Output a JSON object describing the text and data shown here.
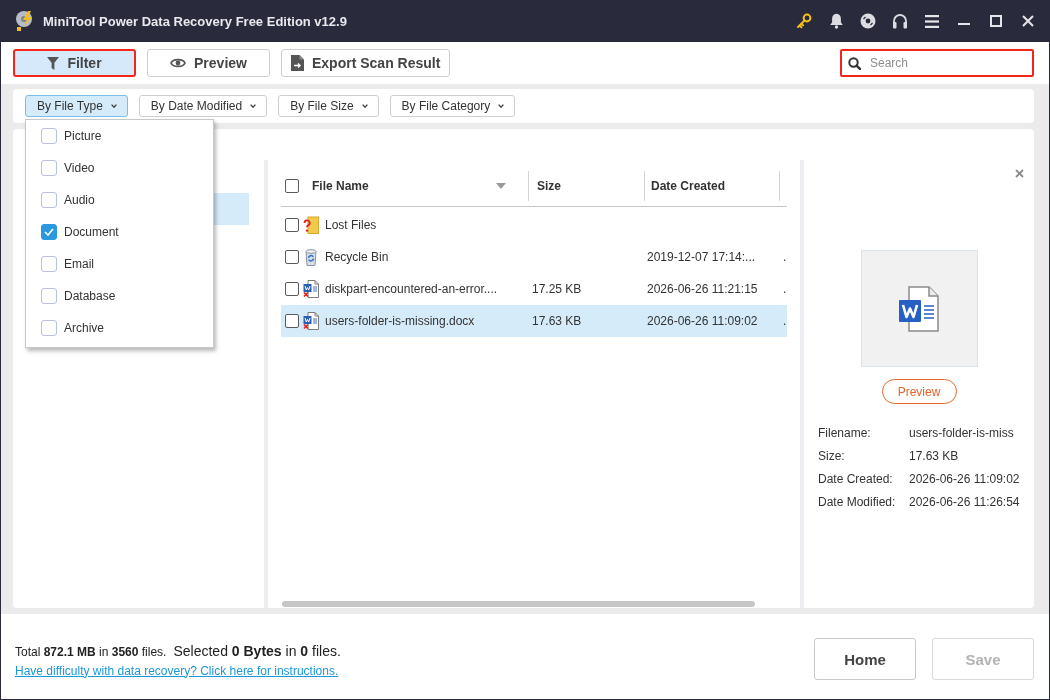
{
  "window": {
    "title": "MiniTool Power Data Recovery Free Edition v12.9"
  },
  "toolbar": {
    "buttons": [
      {
        "kind": "filter",
        "label": "Filter",
        "selected": true,
        "highlighted": true
      },
      {
        "kind": "preview",
        "label": "Preview",
        "selected": false,
        "highlighted": false
      },
      {
        "kind": "export",
        "label": "Export Scan Result",
        "selected": false,
        "highlighted": false
      }
    ],
    "search": {
      "placeholder": "Search",
      "highlighted": true
    }
  },
  "filter_bar": {
    "dropdowns": [
      {
        "label": "By File Type",
        "expanded": true,
        "options": [
          {
            "label": "Picture",
            "checked": false
          },
          {
            "label": "Video",
            "checked": false
          },
          {
            "label": "Audio",
            "checked": false
          },
          {
            "label": "Document",
            "checked": true
          },
          {
            "label": "Email",
            "checked": false
          },
          {
            "label": "Database",
            "checked": false
          },
          {
            "label": "Archive",
            "checked": false
          }
        ]
      },
      {
        "label": "By Date Modified",
        "expanded": false
      },
      {
        "label": "By File Size",
        "expanded": false
      },
      {
        "label": "By File Category",
        "expanded": false
      }
    ]
  },
  "tree": {
    "rows": [
      {
        "selected": true
      }
    ]
  },
  "file_table": {
    "select_all_checked": false,
    "columns": [
      {
        "label": "File Name",
        "sorted": true
      },
      {
        "label": "Size",
        "sorted": false
      },
      {
        "label": "Date Created",
        "sorted": false
      }
    ],
    "rows": [
      {
        "kind": "lost-folder",
        "name": "Lost Files",
        "checked": false,
        "selected": false
      },
      {
        "kind": "recycle-bin",
        "name": "Recycle Bin",
        "date_created": "2019-12-07 17:14:...",
        "column_4": ".",
        "checked": false,
        "selected": false
      },
      {
        "kind": "document",
        "name": "diskpart-encountered-an-error....",
        "size": "17.25 KB",
        "date_created": "2026-06-26 11:21:15",
        "column_4": ".",
        "checked": false,
        "selected": false
      },
      {
        "kind": "document",
        "name": "users-folder-is-missing.docx",
        "size": "17.63 KB",
        "date_created": "2026-06-26 11:09:02",
        "column_4": ".",
        "checked": false,
        "selected": true
      }
    ]
  },
  "preview_panel": {
    "button": "Preview",
    "details": [
      {
        "label": "Filename:",
        "value": "users-folder-is-miss"
      },
      {
        "label": "Size:",
        "value": "17.63 KB"
      },
      {
        "label": "Date Created:",
        "value": "2026-06-26 11:09:02"
      },
      {
        "label": "Date Modified:",
        "value": "2026-06-26 11:26:54"
      }
    ]
  },
  "footer": {
    "summary": "Total **872.1 MB** in **3560** files.",
    "selection": "Selected **0 Bytes** in **0** files.",
    "help_link": "Have difficulty with data recovery? Click here for instructions.",
    "buttons": [
      {
        "label": "Home",
        "disabled": false
      },
      {
        "label": "Save",
        "disabled": true
      }
    ]
  }
}
